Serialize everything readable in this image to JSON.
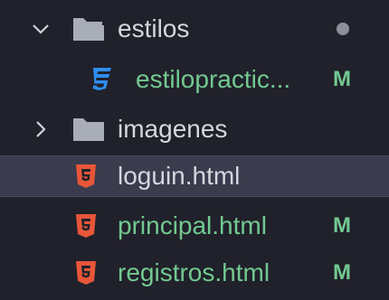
{
  "explorer": {
    "items": [
      {
        "label": "estilos",
        "icon": "folder-open-icon",
        "expanded": true,
        "status": "dot"
      },
      {
        "label": "estilopractic...",
        "icon": "css-file-icon",
        "badge": "M"
      },
      {
        "label": "imagenes",
        "icon": "folder-icon",
        "expanded": false
      },
      {
        "label": "loguin.html",
        "icon": "html-file-icon",
        "selected": true
      },
      {
        "label": "principal.html",
        "icon": "html-file-icon",
        "badge": "M"
      },
      {
        "label": "registros.html",
        "icon": "html-file-icon",
        "badge": "M"
      }
    ]
  },
  "colors": {
    "background": "#20212a",
    "selected_row": "#3a3b4c",
    "modified_text": "#73c991",
    "folder_icon": "#a9adb8",
    "css_icon": "#2f8ef0",
    "html_icon": "#e8563a",
    "dot": "#8c8f9a"
  }
}
